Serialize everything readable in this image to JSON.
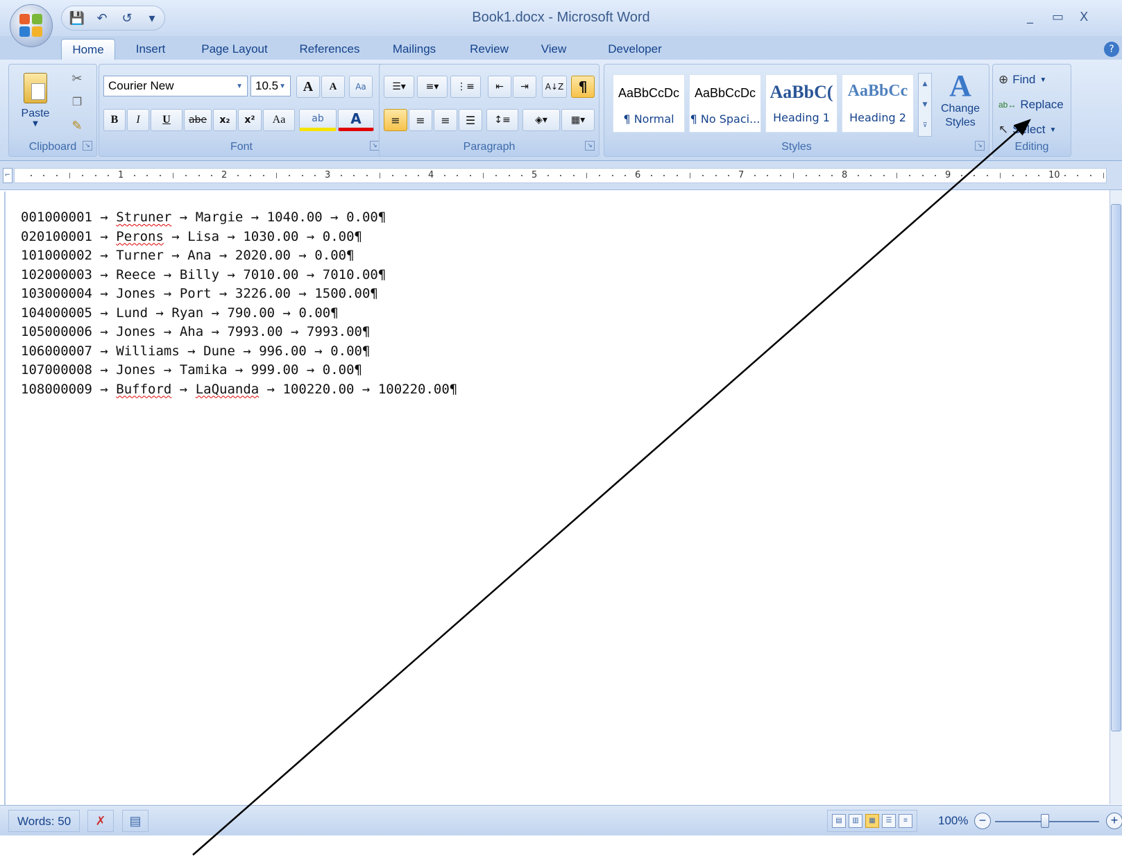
{
  "window": {
    "title": "Book1.docx - Microsoft Word",
    "minimize": "_",
    "restore": "▭",
    "close": "X"
  },
  "qat": {
    "save": "💾",
    "undo": "↶",
    "redo": "↺",
    "customize": "▾"
  },
  "tabs": [
    "Home",
    "Insert",
    "Page Layout",
    "References",
    "Mailings",
    "Review",
    "View",
    "Developer"
  ],
  "active_tab": "Home",
  "ribbon": {
    "clipboard": {
      "label": "Clipboard",
      "paste": "Paste"
    },
    "font": {
      "label": "Font",
      "font_name": "Courier New",
      "font_size": "10.5",
      "grow": "A",
      "shrink": "A",
      "clear": "Aa",
      "bold": "B",
      "italic": "I",
      "underline": "U",
      "strike": "abe",
      "subscript": "x₂",
      "superscript": "x²",
      "case": "Aa",
      "highlight": "ab",
      "color": "A"
    },
    "paragraph": {
      "label": "Paragraph",
      "sort": "A↓Z",
      "pilcrow": "¶"
    },
    "styles": {
      "label": "Styles",
      "items": [
        {
          "preview": "AaBbCcDc",
          "name": "¶ Normal"
        },
        {
          "preview": "AaBbCcDc",
          "name": "¶ No Spaci..."
        },
        {
          "preview": "AaBbC(",
          "name": "Heading 1"
        },
        {
          "preview": "AaBbCc",
          "name": "Heading 2"
        }
      ],
      "change_styles": "Change Styles"
    },
    "editing": {
      "label": "Editing",
      "find": "Find",
      "replace": "Replace",
      "select": "Select"
    }
  },
  "ruler": {
    "numbers": [
      "1",
      "2",
      "3",
      "4",
      "5",
      "6",
      "7",
      "8",
      "9",
      "10"
    ]
  },
  "document": {
    "lines": [
      [
        "001000001",
        "Struner",
        "Margie",
        "1040.00",
        "0.00"
      ],
      [
        "020100001",
        "Perons",
        "Lisa",
        "1030.00",
        "0.00"
      ],
      [
        "101000002",
        "Turner",
        "Ana",
        "2020.00",
        "0.00"
      ],
      [
        "102000003",
        "Reece",
        "Billy",
        "7010.00",
        "7010.00"
      ],
      [
        "103000004",
        "Jones",
        "Port",
        "3226.00",
        "1500.00"
      ],
      [
        "104000005",
        "Lund",
        "Ryan",
        "790.00",
        "0.00"
      ],
      [
        "105000006",
        "Jones",
        "Aha",
        "7993.00",
        "7993.00"
      ],
      [
        "106000007",
        "Williams",
        "Dune",
        "996.00",
        "0.00"
      ],
      [
        "107000008",
        "Jones",
        "Tamika",
        "999.00",
        "0.00"
      ],
      [
        "108000009",
        "Bufford",
        "LaQuanda",
        "100220.00",
        "100220.00"
      ]
    ],
    "misspelled": [
      "Struner",
      "Perons",
      "Bufford",
      "LaQuanda"
    ]
  },
  "status": {
    "words": "Words: 50",
    "zoom": "100%",
    "zoom_out": "−",
    "zoom_in": "+"
  },
  "colors": {
    "annotation": "#000000",
    "squiggle": "#e00000",
    "ribbon_text": "#15428b"
  }
}
